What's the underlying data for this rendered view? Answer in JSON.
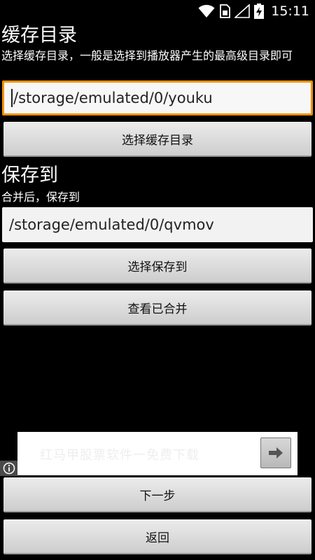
{
  "status_bar": {
    "time": "15:11",
    "icons": [
      "wifi-icon",
      "sim-card-icon",
      "signal-icon",
      "battery-charging-icon"
    ]
  },
  "cache_section": {
    "title": "缓存目录",
    "description": "选择缓存目录，一般是选择到播放器产生的最高级目录即可",
    "path_value": "/storage/emulated/0/youku",
    "button_label": "选择缓存目录"
  },
  "save_section": {
    "title": "保存到",
    "description": "合并后，保存到",
    "path_value": "/storage/emulated/0/qvmov",
    "button_label": "选择保存到",
    "view_button_label": "查看已合并"
  },
  "ad": {
    "text": "红马甲股票软件一免费下载",
    "arrow_icon": "arrow-right-icon",
    "info_icon": "info-icon"
  },
  "footer": {
    "next_label": "下一步",
    "back_label": "返回"
  },
  "colors": {
    "focus_border": "#f39000",
    "background": "#000000"
  }
}
